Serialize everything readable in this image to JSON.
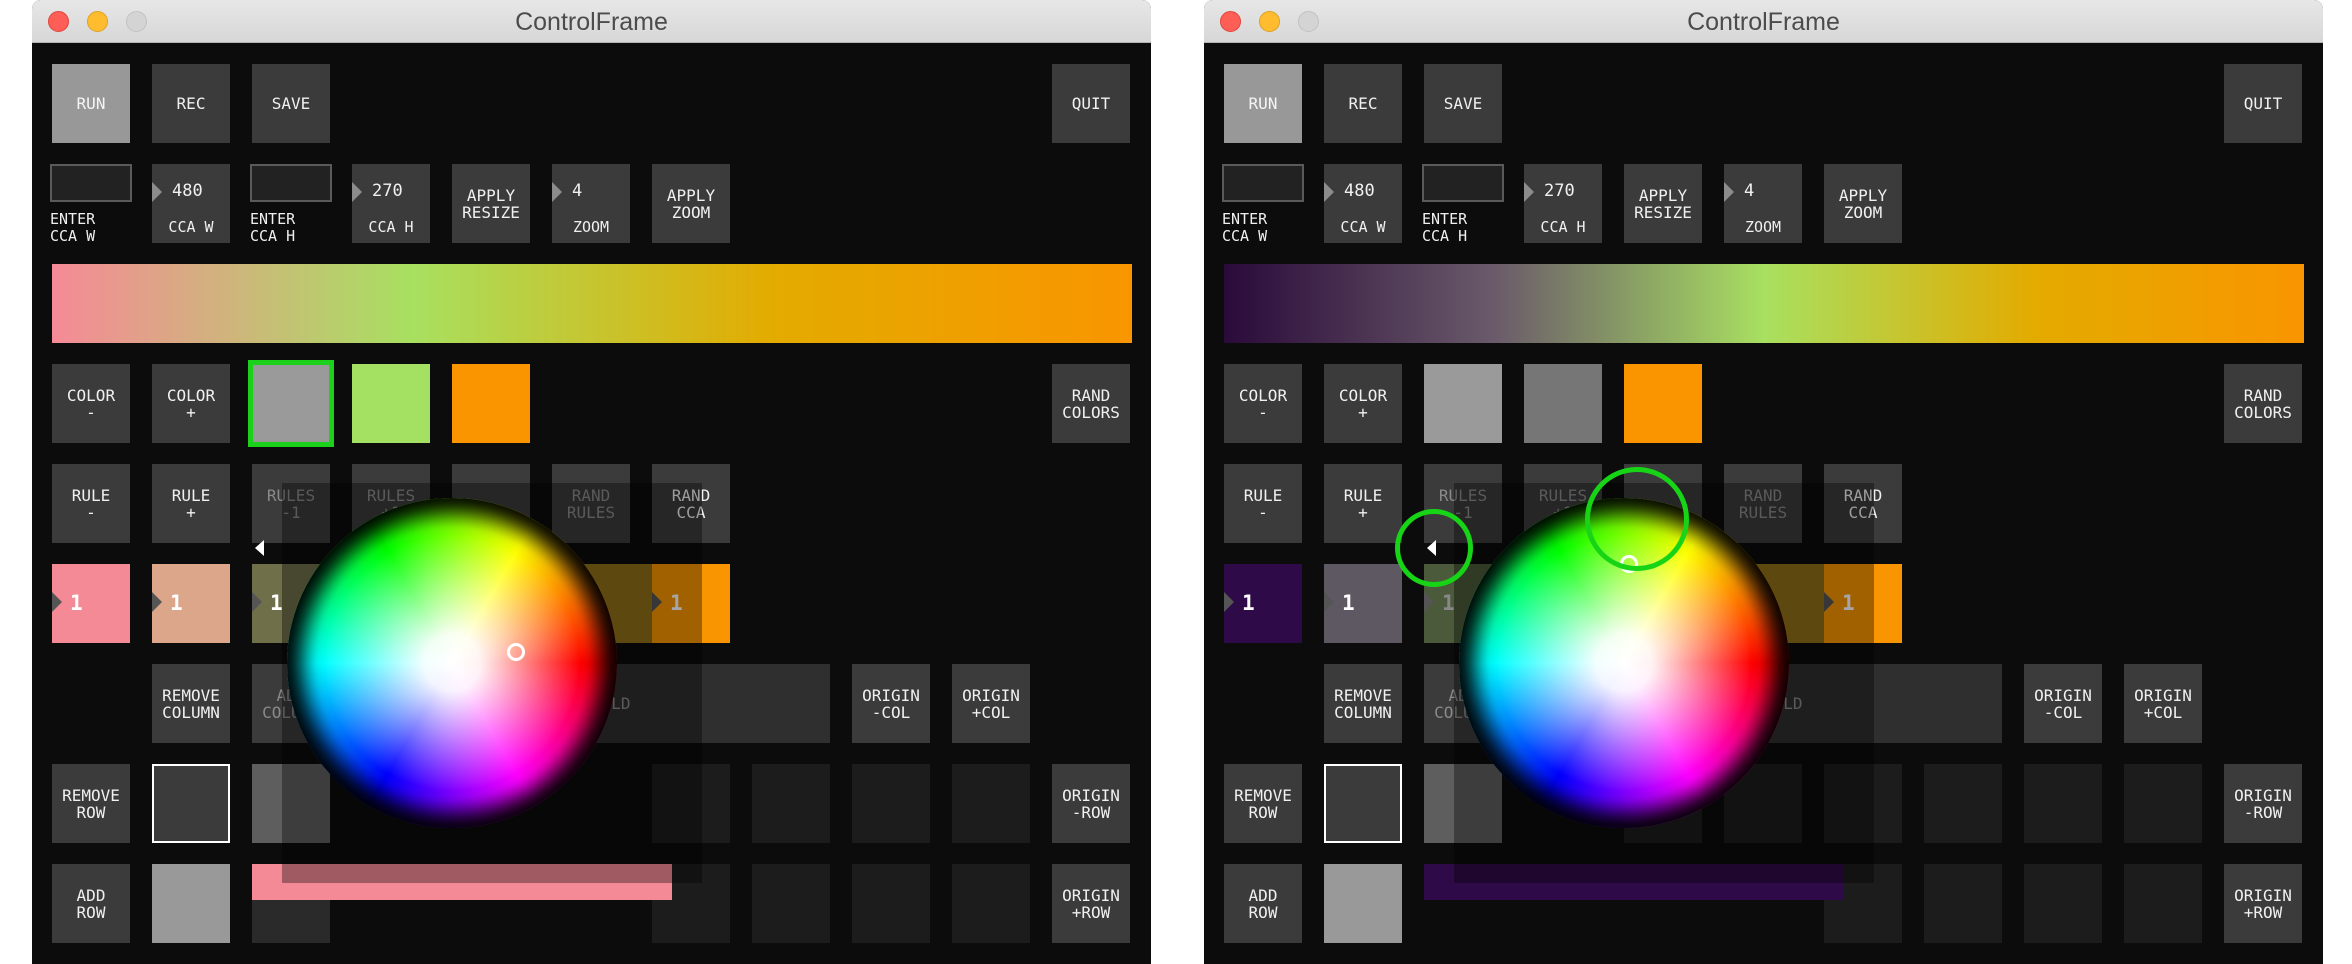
{
  "windows": [
    {
      "title": "ControlFrame",
      "buttons": {
        "run": "RUN",
        "rec": "REC",
        "save": "SAVE",
        "quit": "QUIT"
      },
      "size_controls": {
        "enter_w_label": "ENTER\nCCA W",
        "w_value": "480",
        "w_caption": "CCA W",
        "enter_h_label": "ENTER\nCCA H",
        "h_value": "270",
        "h_caption": "CCA H",
        "apply_resize": "APPLY\nRESIZE",
        "zoom_value": "4",
        "zoom_caption": "ZOOM",
        "apply_zoom": "APPLY\nZOOM"
      },
      "gradient_colors": [
        "#f58a97",
        "#a8e060",
        "#e3ab00",
        "#f99500"
      ],
      "color_buttons": {
        "minus": "COLOR\n-",
        "plus": "COLOR\n+",
        "rand": "RAND\nCOLORS"
      },
      "swatches": [
        "#9a9a9a",
        "#a4e062",
        "#fa9500"
      ],
      "selected_swatch": 0,
      "rule_buttons": {
        "rule_minus": "RULE\n-",
        "rule_plus": "RULE\n+",
        "rules_minus1": "RULES\n-1",
        "rules_plus1": "RULES\n+1",
        "rand_rules": "RAND\nRULES",
        "rand_cca": "RAND\nCCA"
      },
      "rule_cells": [
        {
          "color": "#f58a97",
          "value": "1"
        },
        {
          "color": "#dba68a",
          "value": "1"
        },
        {
          "color": "#6f6f4a",
          "value": "1"
        },
        {
          "color": "#907018",
          "value": "1"
        },
        {
          "color": "#f99500",
          "value": "1"
        }
      ],
      "row_col_buttons": {
        "remove_column": "REMOVE\nCOLUMN",
        "add_column": "ADD\nCOLUMN",
        "hold": "HOLD",
        "origin_minus_col": "ORIGIN\n-COL",
        "origin_plus_col": "ORIGIN\n+COL",
        "remove_row": "REMOVE\nROW",
        "origin_minus_row": "ORIGIN\n-ROW",
        "add_row": "ADD\nROW",
        "origin_plus_row": "ORIGIN\n+ROW"
      },
      "bar_color": "#f58a97"
    },
    {
      "title": "ControlFrame",
      "buttons": {
        "run": "RUN",
        "rec": "REC",
        "save": "SAVE",
        "quit": "QUIT"
      },
      "size_controls": {
        "enter_w_label": "ENTER\nCCA W",
        "w_value": "480",
        "w_caption": "CCA W",
        "enter_h_label": "ENTER\nCCA H",
        "h_value": "270",
        "h_caption": "CCA H",
        "apply_resize": "APPLY\nRESIZE",
        "zoom_value": "4",
        "zoom_caption": "ZOOM",
        "apply_zoom": "APPLY\nZOOM"
      },
      "gradient_colors": [
        "#2a0a3a",
        "#6a5a6a",
        "#a8e060",
        "#e3ab00",
        "#f99500"
      ],
      "color_buttons": {
        "minus": "COLOR\n-",
        "plus": "COLOR\n+",
        "rand": "RAND\nCOLORS"
      },
      "swatches": [
        "#9a9a9a",
        "#767676",
        "#fa9500"
      ],
      "selected_swatch": -1,
      "rule_buttons": {
        "rule_minus": "RULE\n-",
        "rule_plus": "RULE\n+",
        "rules_minus1": "RULES\n-1",
        "rules_plus1": "RULES\n+1",
        "rand_rules": "RAND\nRULES",
        "rand_cca": "RAND\nCCA"
      },
      "rule_cells": [
        {
          "color": "#2e0a48",
          "value": "1"
        },
        {
          "color": "#5e5862",
          "value": "1"
        },
        {
          "color": "#4a5a3a",
          "value": "1"
        },
        {
          "color": "#907018",
          "value": "1"
        },
        {
          "color": "#f99500",
          "value": "1"
        }
      ],
      "row_col_buttons": {
        "remove_column": "REMOVE\nCOLUMN",
        "add_column": "ADD\nCOLUMN",
        "hold": "HOLD",
        "origin_minus_col": "ORIGIN\n-COL",
        "origin_plus_col": "ORIGIN\n+COL",
        "remove_row": "REMOVE\nROW",
        "origin_minus_row": "ORIGIN\n-ROW",
        "add_row": "ADD\nROW",
        "origin_plus_row": "ORIGIN\n+ROW"
      },
      "bar_color": "#2e0a48"
    }
  ]
}
